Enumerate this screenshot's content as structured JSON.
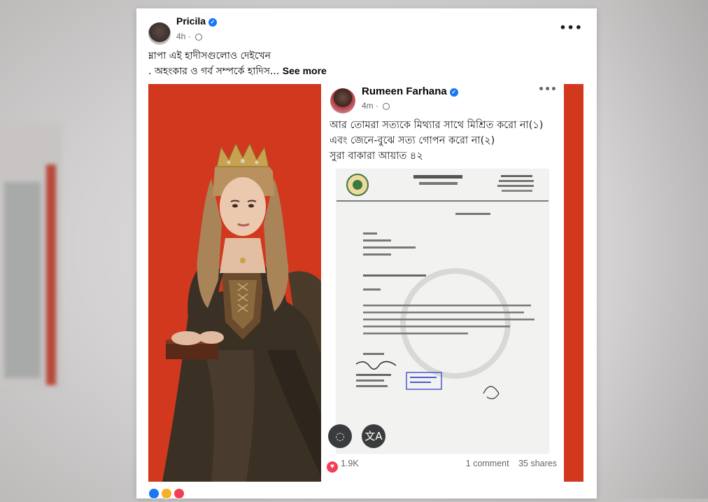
{
  "post": {
    "author": "Pricila",
    "time": "4h",
    "caption_line1": "ম্নাপা এই হাদীসগুলোও দেইখেন",
    "caption_line2": ". অহংকার ও গর্ব সম্পর্কে হাদিস...",
    "see_more": "See more",
    "more_icon": "•••"
  },
  "embedded_post": {
    "author": "Rumeen Farhana",
    "time": "4m",
    "more_icon": "•••",
    "text_line1": "আর তোমরা সত্যকে মিথ্যার সাথে মিশ্রিত করো না(১)",
    "text_line2": "এবং জেনে-বুঝে সত্য গোপন করো না(২)",
    "text_line3": "সুরা বাকারা আয়াত ৪২",
    "reactions_count": "1.9K",
    "comments": "1 comment",
    "shares": "35 shares"
  },
  "colors": {
    "media_background": "#d2381e",
    "verified": "#1877f2",
    "heart": "#f33e58"
  },
  "icons": {
    "verified": "verified-badge-icon",
    "globe": "globe-icon",
    "translate": "translate-icon"
  }
}
